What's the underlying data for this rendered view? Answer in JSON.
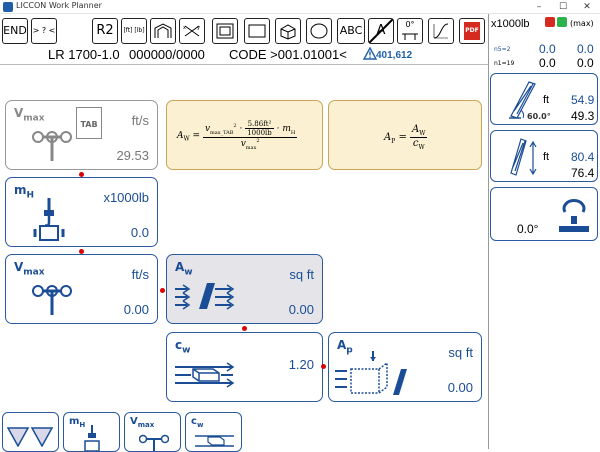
{
  "window": {
    "title": "LICCON Work Planner",
    "minimize": "–",
    "maximize": "☐",
    "close": "✕"
  },
  "toolbar": {
    "end_label": "END",
    "compare_label": "> ? <",
    "r2_label": "R2",
    "units_label": "[ft] [lb]",
    "abc_label": "ABC",
    "a_label": "A",
    "angle_label": "0°",
    "pdf_label": "PDF"
  },
  "info": {
    "config": "LR 1700-1.0",
    "number": "000000/0000",
    "code": "CODE >001.01001<",
    "warning_value": "401,612"
  },
  "cards": {
    "vmax_tab": {
      "symbol": "V",
      "sub": "max",
      "badge": "TAB",
      "unit": "ft/s",
      "value": "29.53"
    },
    "mh": {
      "symbol": "m",
      "sub": "H",
      "unit": "x1000lb",
      "value": "0.0"
    },
    "vmax": {
      "symbol": "V",
      "sub": "max",
      "unit": "ft/s",
      "value": "0.00"
    },
    "aw": {
      "symbol": "A",
      "sub": "w",
      "unit": "sq ft",
      "value": "0.00"
    },
    "cw": {
      "symbol": "c",
      "sub": "w",
      "value": "1.20"
    },
    "ap": {
      "symbol": "A",
      "sub": "p",
      "unit": "sq ft",
      "value": "0.00"
    }
  },
  "formulas": {
    "aw_lhs": "A",
    "aw_lhs_sub": "W",
    "aw_num_a": "v",
    "aw_num_a_sub": "max_TAB",
    "aw_num_sup": "2",
    "aw_coef_num": "5.86ft²",
    "aw_coef_den": "1000lb",
    "aw_mh": "· m",
    "aw_mh_sub": "H",
    "aw_den": "v",
    "aw_den_sub": "max",
    "aw_den_sup": "2",
    "ap_lhs": "A",
    "ap_lhs_sub": "P",
    "ap_num": "A",
    "ap_num_sub": "W",
    "ap_den": "c",
    "ap_den_sub": "W"
  },
  "right_panel": {
    "unit": "x1000lb",
    "max_label": "(max)",
    "n5_label": "n5=2",
    "n1_label": "n1=19",
    "row1_a": "0.0",
    "row1_b": "0.0",
    "row2_a": "0.0",
    "row2_b": "0.0",
    "boom_unit": "ft",
    "boom_angle": "60.0°",
    "boom_length": "54.9",
    "boom_radius": "49.3",
    "height_unit": "ft",
    "height_a": "80.4",
    "height_b": "76.4",
    "slew_angle": "0.0°"
  },
  "bottom_nav": {
    "mh_symbol": "m",
    "mh_sub": "H",
    "vmax_symbol": "V",
    "vmax_sub": "max",
    "cw_symbol": "c",
    "cw_sub": "w"
  },
  "colors": {
    "accent": "#2c5aa0",
    "formula_bg": "#fbf0d2",
    "shaded_bg": "#e5e5e9",
    "marker": "#dd0000"
  }
}
